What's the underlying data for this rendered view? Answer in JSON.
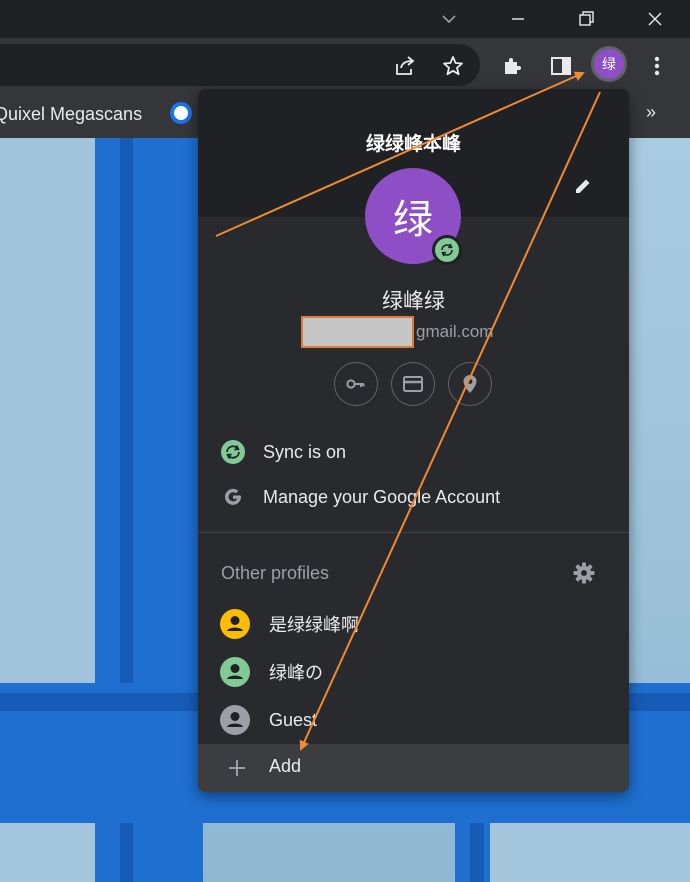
{
  "window": {
    "controls": [
      "chevron-down-icon",
      "minimize-icon",
      "restore-icon",
      "close-icon"
    ]
  },
  "toolbar": {
    "icons": [
      "share-icon",
      "star-icon",
      "extensions-icon",
      "side-panel-icon",
      "more-icon"
    ],
    "profile_button_text": "绿"
  },
  "bookmarks": {
    "item_label": "Quixel Megascans",
    "overflow": "»"
  },
  "menu": {
    "title": "绿绿峰本峰",
    "avatar_text": "绿",
    "name": "绿峰绿",
    "email_suffix": "gmail.com",
    "quick_actions": [
      "key-icon",
      "credit-card-icon",
      "location-icon"
    ],
    "sync_label": "Sync is on",
    "manage_label": "Manage your Google Account",
    "other_profiles_title": "Other profiles",
    "profiles": [
      {
        "label": "是绿绿峰啊",
        "color": "#fbbc04"
      },
      {
        "label": "绿峰の",
        "color": "#81c995"
      },
      {
        "label": "Guest",
        "color": "#9aa0a6"
      }
    ],
    "add_label": "Add"
  },
  "colors": {
    "accent_purple": "#8e4ec6",
    "sync_green": "#81c995",
    "annotation_orange": "#f08a32"
  }
}
